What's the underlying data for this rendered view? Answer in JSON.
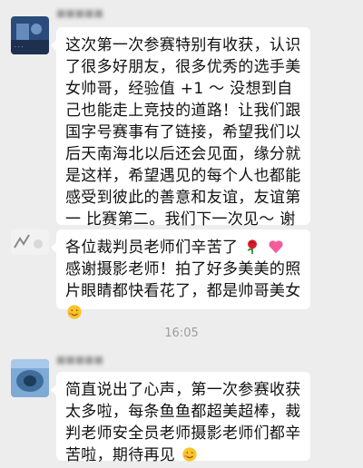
{
  "messages": [
    {
      "sender": "■■■■■",
      "text": "这次第一次参赛特别有收获，认识了很多好朋友，很多优秀的选手美女帅哥，经验值 +1 ～ 没想到自己也能走上竞技的道路！让我们跟国字号赛事有了链接，希望我们以后天南海北以后还会见面，缘分就是这样，希望遇见的每个人也都能感受到彼此的善意和友谊，友谊第一 比赛第二。我们下一次见～ 谢谢所有的各位，完美落幕"
    },
    {
      "sender": "",
      "text_a": "各位裁判员老师们辛苦了",
      "text_b": "感谢摄影老师！拍了好多美美的照片眼睛都快看花了，都是帅哥美女"
    },
    {
      "sender": "■■■■■",
      "text": "简直说出了心声，第一次参赛收获太多啦，每条鱼鱼都超美超棒，裁判老师安全员老师摄影老师们都辛苦啦，期待再见"
    }
  ],
  "timestamp": "16:05",
  "icons": {
    "rose": "rose-emoji-icon",
    "heart": "pink-heart-emoji-icon",
    "smile": "shy-smile-emoji-icon"
  }
}
